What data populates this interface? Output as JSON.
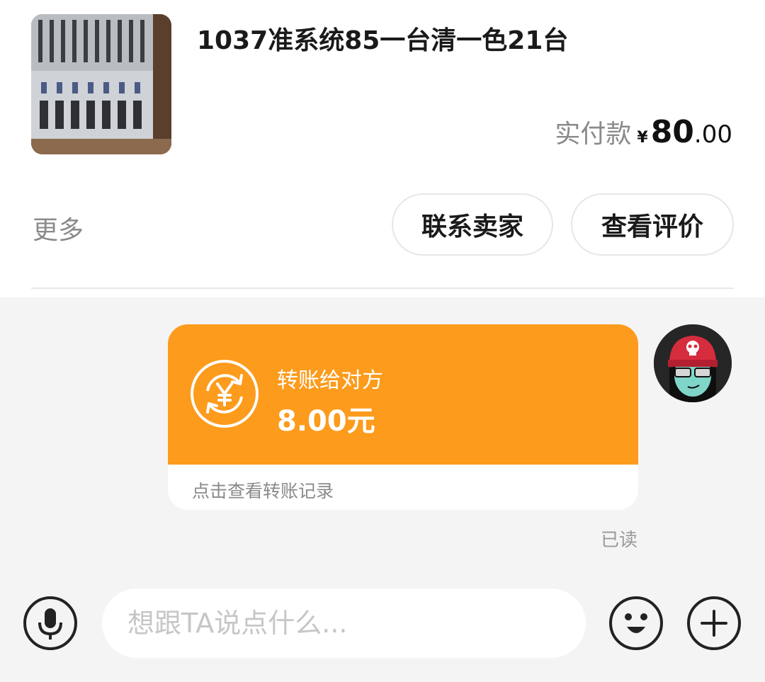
{
  "order": {
    "title": "1037准系统85一台清一色21台",
    "price_label": "实付款",
    "currency": "¥",
    "price_integer": "80",
    "price_decimal": ".00"
  },
  "actions": {
    "more_label": "更多",
    "contact_seller_label": "联系卖家",
    "view_review_label": "查看评价"
  },
  "transfer": {
    "title": "转账给对方",
    "amount": "8.00元",
    "footer": "点击查看转账记录",
    "accent_color": "#fd9b1c"
  },
  "message_status": "已读",
  "composer": {
    "placeholder": "想跟TA说点什么...",
    "value": ""
  },
  "icons": {
    "voice": "microphone-icon",
    "emoji": "smiley-icon",
    "more": "plus-icon"
  }
}
